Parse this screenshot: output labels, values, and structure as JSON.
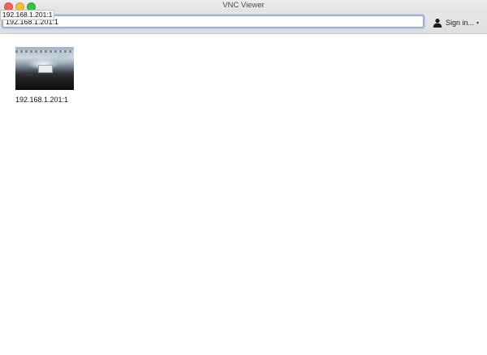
{
  "window": {
    "title": "VNC Viewer"
  },
  "toolbar": {
    "tooltip": "192.168.1.201:1",
    "address_value": "192.168.1.201:1",
    "signin_label": "Sign in...",
    "signin_icon": "user-avatar-icon",
    "signin_chevron": "▾"
  },
  "connections": [
    {
      "label": "192.168.1.201:1",
      "thumbnail": "desktop-preview"
    }
  ],
  "colors": {
    "close": "#fe5f57",
    "minimize": "#febc2e",
    "maximize": "#28c840",
    "focus_ring": "#a6c6f4"
  }
}
